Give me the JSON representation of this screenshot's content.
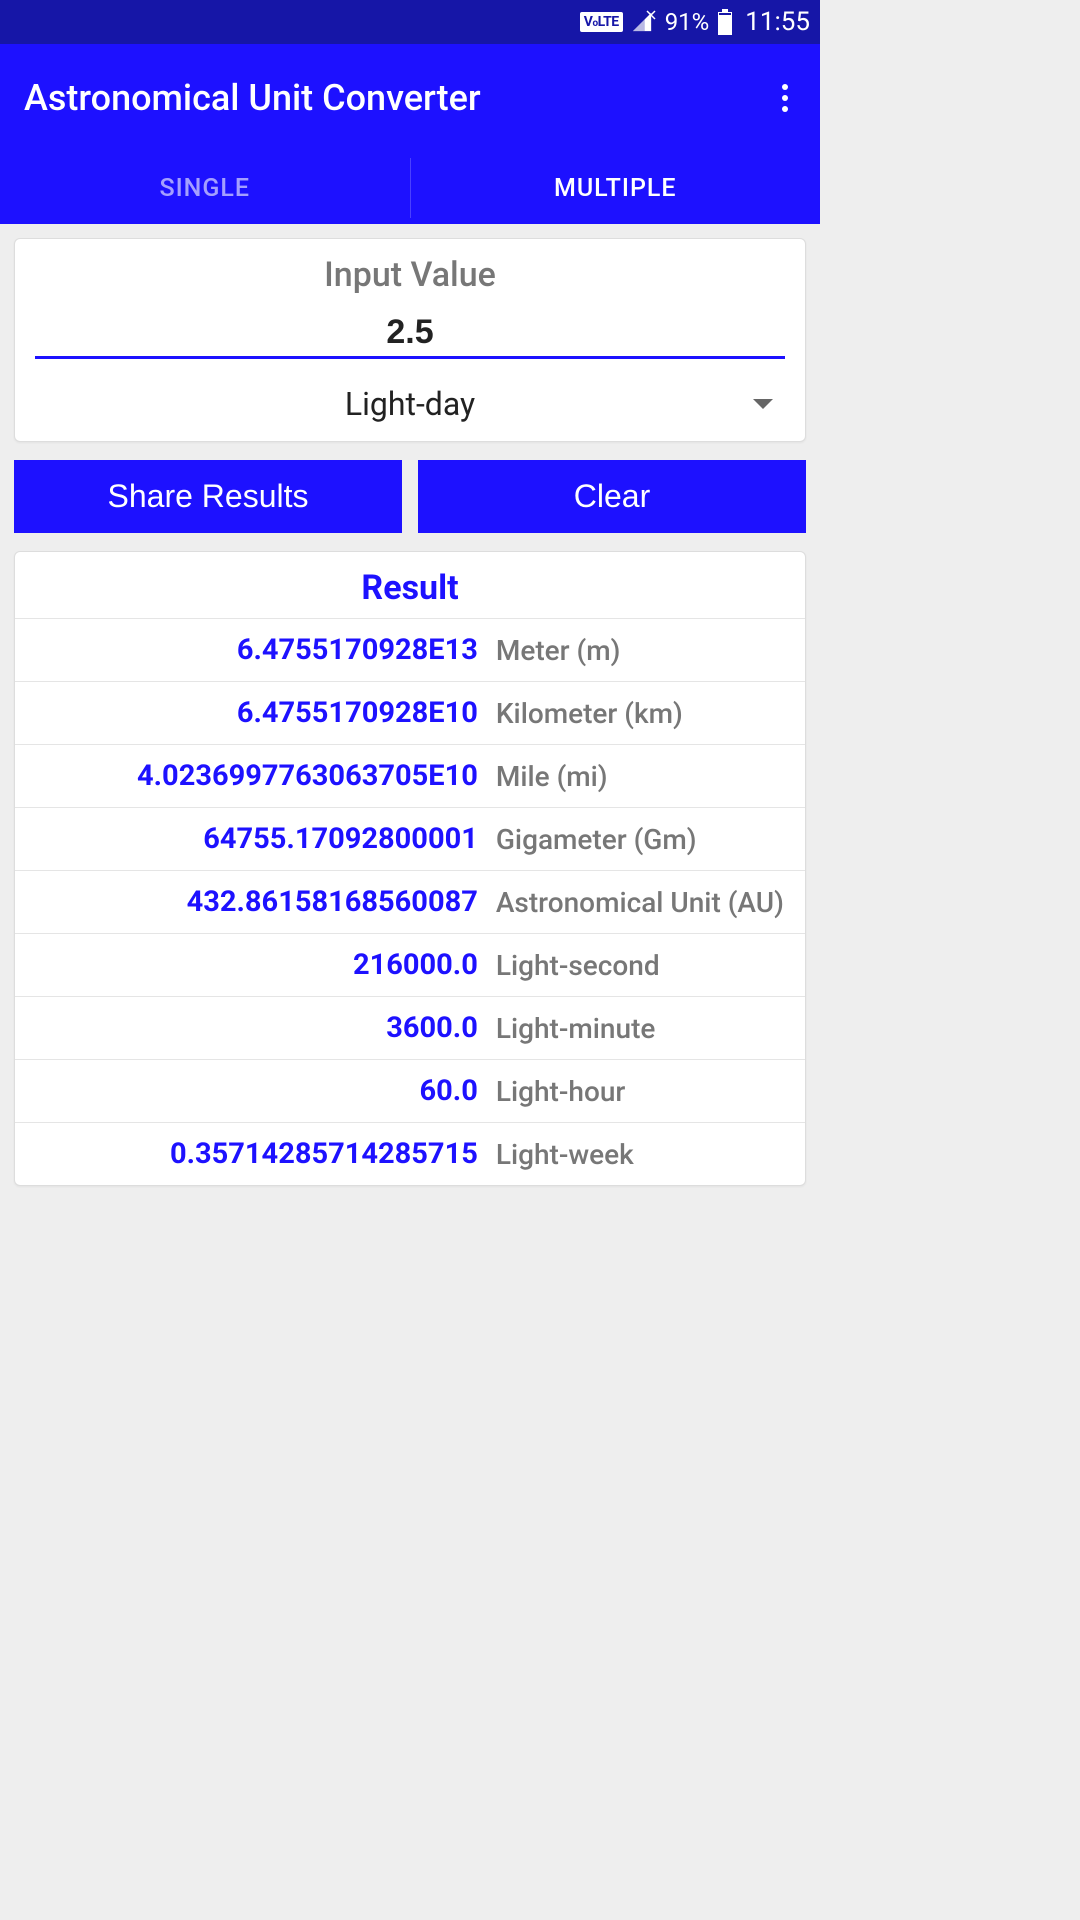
{
  "status": {
    "volte": "V LTE",
    "battery_pct": "91%",
    "time": "11:55"
  },
  "app": {
    "title": "Astronomical Unit Converter"
  },
  "tabs": {
    "single": "SINGLE",
    "multiple": "MULTIPLE"
  },
  "input": {
    "label": "Input Value",
    "value": "2.5",
    "unit": "Light-day"
  },
  "buttons": {
    "share": "Share Results",
    "clear": "Clear"
  },
  "results": {
    "title": "Result",
    "rows": [
      {
        "value": "6.4755170928E13",
        "unit": "Meter (m)"
      },
      {
        "value": "6.4755170928E10",
        "unit": "Kilometer (km)"
      },
      {
        "value": "4.0236997763063705E10",
        "unit": "Mile (mi)"
      },
      {
        "value": "64755.17092800001",
        "unit": "Gigameter (Gm)"
      },
      {
        "value": "432.86158168560087",
        "unit": "Astronomical Unit (AU)"
      },
      {
        "value": "216000.0",
        "unit": "Light-second"
      },
      {
        "value": "3600.0",
        "unit": "Light-minute"
      },
      {
        "value": "60.0",
        "unit": "Light-hour"
      },
      {
        "value": "0.35714285714285715",
        "unit": "Light-week"
      }
    ]
  }
}
